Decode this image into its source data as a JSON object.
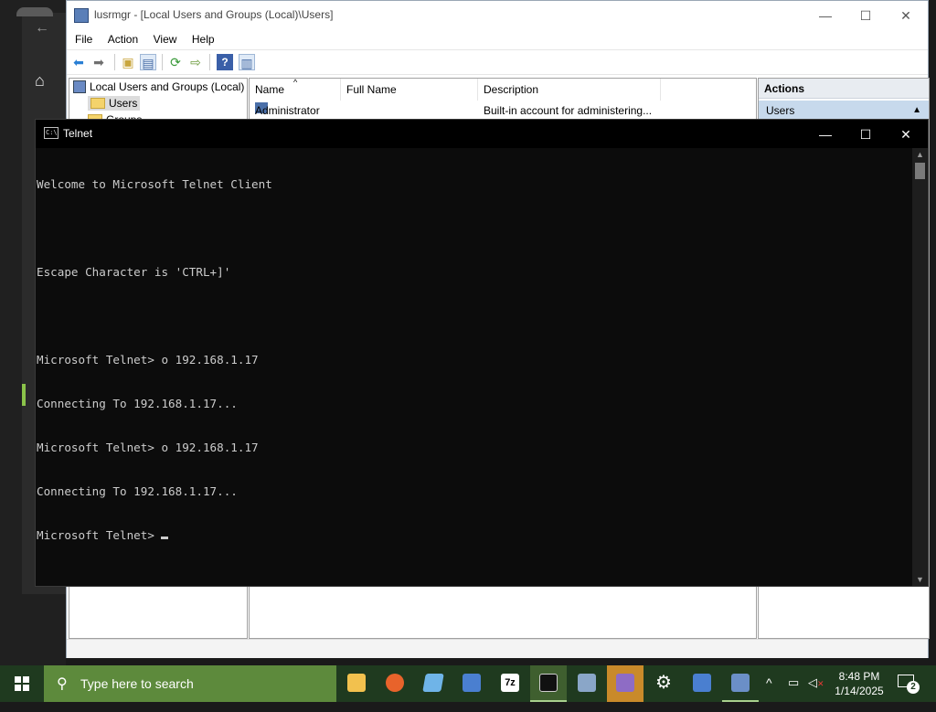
{
  "lusrmgr": {
    "title": "lusrmgr - [Local Users and Groups (Local)\\Users]",
    "minimize": "—",
    "maximize": "☐",
    "close": "✕",
    "menu": [
      "File",
      "Action",
      "View",
      "Help"
    ],
    "tree": {
      "root": "Local Users and Groups (Local)",
      "users": "Users",
      "groups": "Groups"
    },
    "columns": [
      "Name",
      "Full Name",
      "Description"
    ],
    "rows": [
      {
        "name": "Administrator",
        "full_name": "",
        "description": "Built-in account for administering..."
      }
    ],
    "actions": {
      "header": "Actions",
      "selected": "Users",
      "arrow": "▲"
    }
  },
  "telnet": {
    "title": "Telnet",
    "minimize": "—",
    "maximize": "☐",
    "close": "✕",
    "lines": [
      "Welcome to Microsoft Telnet Client",
      "",
      "Escape Character is 'CTRL+]'",
      "",
      "Microsoft Telnet> o 192.168.1.17",
      "Connecting To 192.168.1.17...",
      "Microsoft Telnet> o 192.168.1.17",
      "Connecting To 192.168.1.17...",
      "Microsoft Telnet> "
    ]
  },
  "taskbar": {
    "search_placeholder": "Type here to search",
    "time": "8:48 PM",
    "date": "1/14/2025",
    "notification_count": "2",
    "apps": [
      {
        "name": "file-explorer",
        "color": "#f2c14e"
      },
      {
        "name": "firefox",
        "color": "#e8632b"
      },
      {
        "name": "notepad",
        "color": "#6fb4e8"
      },
      {
        "name": "remote-desktop",
        "color": "#4a7fd0"
      },
      {
        "name": "7zip",
        "color": "#ffffff"
      },
      {
        "name": "telnet-console",
        "color": "#111111"
      },
      {
        "name": "computer-management",
        "color": "#8aa6c8"
      },
      {
        "name": "visual-studio",
        "color": "#8e6cc5"
      },
      {
        "name": "settings",
        "color": "#ffffff"
      },
      {
        "name": "network",
        "color": "#4a7fd0"
      },
      {
        "name": "lusrmgr",
        "color": "#6b8fc7"
      }
    ]
  }
}
